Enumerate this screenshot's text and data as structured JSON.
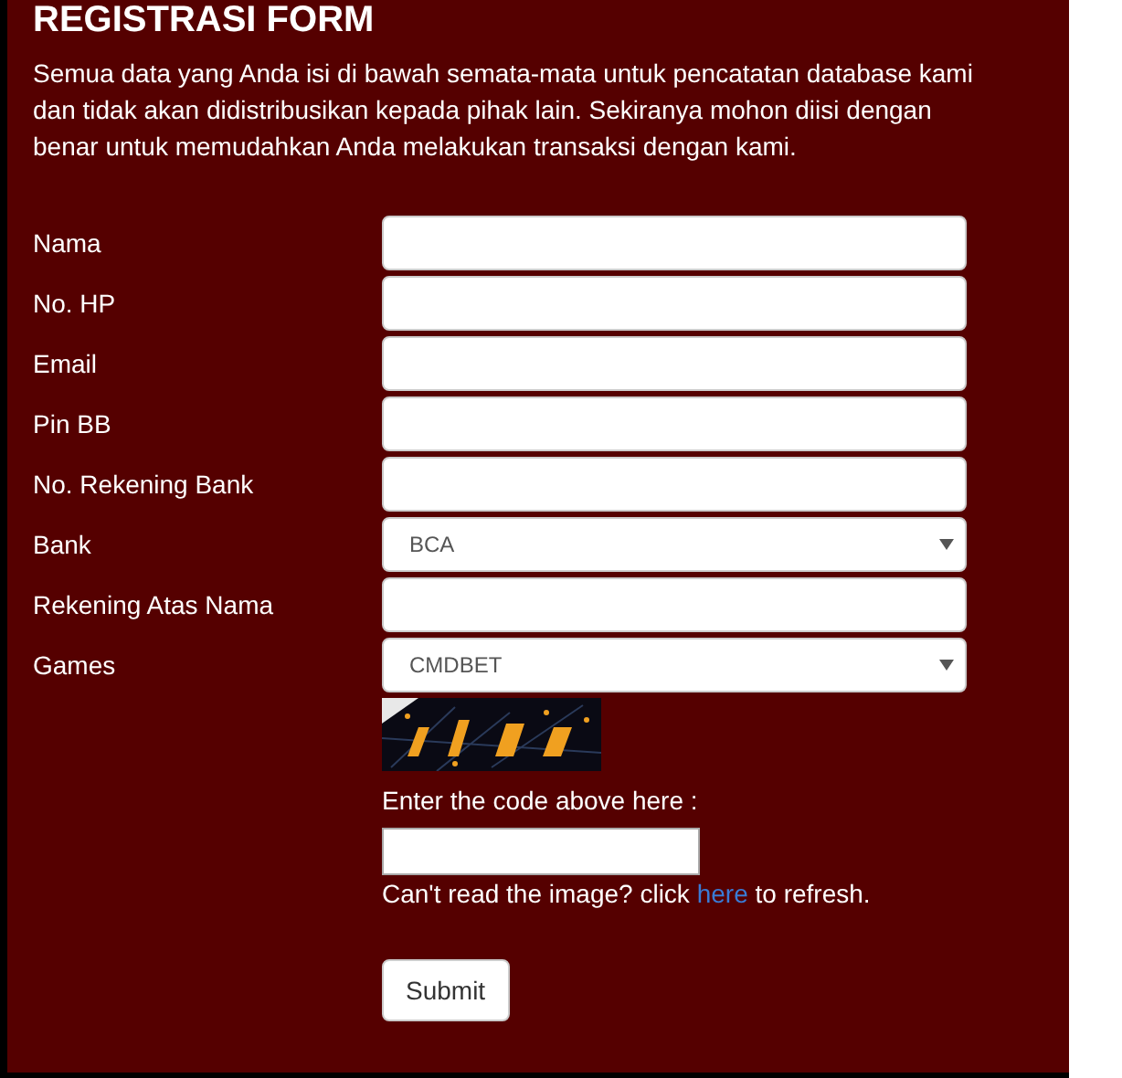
{
  "title": "REGISTRASI FORM",
  "intro": "Semua data yang Anda isi di bawah semata-mata untuk pencatatan database kami dan tidak akan didistribusikan kepada pihak lain. Sekiranya mohon diisi dengan benar untuk memudahkan Anda melakukan transaksi dengan kami.",
  "fields": [
    {
      "kind": "text",
      "label": "Nama"
    },
    {
      "kind": "text",
      "label": "No. HP"
    },
    {
      "kind": "text",
      "label": "Email"
    },
    {
      "kind": "text",
      "label": "Pin BB"
    },
    {
      "kind": "text",
      "label": "No. Rekening Bank"
    },
    {
      "kind": "select",
      "label": "Bank",
      "value": "BCA"
    },
    {
      "kind": "text",
      "label": "Rekening Atas Nama"
    },
    {
      "kind": "select",
      "label": "Games",
      "value": "CMDBET"
    }
  ],
  "captcha": {
    "kind": "picture",
    "prompt": "Enter the code above here :",
    "hint_before": "Can't read the image? click",
    "link": "here",
    "hint_after": "to refresh."
  },
  "submit": "Submit"
}
